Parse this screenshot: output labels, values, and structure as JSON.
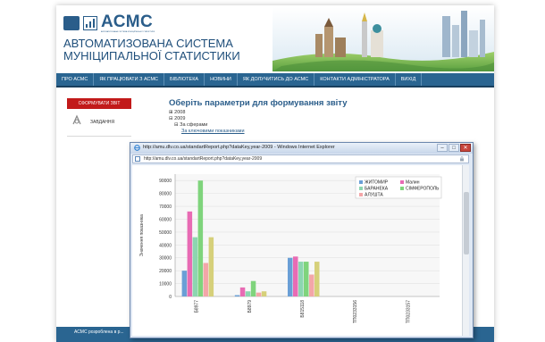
{
  "site": {
    "logo": "АСМС",
    "logo_sub": "АВТОМАТИЗОВАНА СИСТЕМА МУНІЦИПАЛЬНОЇ СТАТИСТИКИ",
    "title_line1": "АВТОМАТИЗОВАНА СИСТЕМА",
    "title_line2": "МУНІЦИПАЛЬНОЇ СТАТИСТИКИ"
  },
  "nav": {
    "items": [
      "ПРО АСМС",
      "ЯК ПРАЦЮВАТИ З АСМС",
      "БІБЛІОТЕКА",
      "НОВИНИ",
      "ЯК ДОЛУЧИТИСЬ ДО АСМС",
      "КОНТАКТИ АДМІНІСТРАТОРА",
      "ВИХІД"
    ]
  },
  "sidebar": {
    "button_label": "СФОРМУВАТИ ЗВІТ",
    "item_label": "ЗАВДАННЯ"
  },
  "main": {
    "title": "Оберіть параметри для формування звіту",
    "tree": [
      "⊞ 2008",
      "⊟ 2009",
      "⊟ За сферами",
      "За ключовими показниками"
    ]
  },
  "footer": {
    "text": "АСМС розроблена в р..."
  },
  "popup": {
    "title": "http://amu.dlv.co.ua/standartReport.php?dataKey,year-2009 - Windows Internet Explorer",
    "address": "http://amu.dlv.co.ua/standartReport.php?dataKey,year-2009",
    "btn_min": "–",
    "btn_max": "□",
    "btn_close": "✕"
  },
  "colors": {
    "nav_bg": "#2a6591",
    "brand_blue": "#2a5d8a",
    "sidebar_button": "#c21a1a"
  },
  "chart_data": {
    "type": "bar",
    "categories": [
      "Б8977",
      "Б8979",
      "Б815118",
      "ТП0233156",
      "ТП0233157"
    ],
    "series": [
      {
        "name": "ЖИТОМИР",
        "color": "#6a9fd6",
        "values": [
          20000,
          1000,
          30000,
          0,
          0
        ]
      },
      {
        "name": "Малин",
        "color": "#e86bb4",
        "values": [
          66000,
          7000,
          31000,
          0,
          0
        ]
      },
      {
        "name": "БАРАНЕКА",
        "color": "#8cd6b0",
        "values": [
          46000,
          4000,
          27000,
          0,
          0
        ]
      },
      {
        "name": "СІМФЕРОПОЛЬ",
        "color": "#7fd47c",
        "values": [
          90000,
          12000,
          27000,
          0,
          0
        ]
      },
      {
        "name": "АЛУШТА",
        "color": "#f3a6a8",
        "values": [
          26000,
          3000,
          17000,
          0,
          0
        ]
      },
      {
        "name": "",
        "color": "#d6d07a",
        "values": [
          46000,
          4000,
          27000,
          0,
          0
        ]
      }
    ],
    "yticks": [
      "0",
      "10000",
      "20000",
      "30000",
      "40000",
      "50000",
      "60000",
      "70000",
      "80000",
      "90000"
    ],
    "ylabel": "Значення показника",
    "ylim": [
      0,
      95000
    ],
    "legend": "top-right",
    "grid": true
  }
}
